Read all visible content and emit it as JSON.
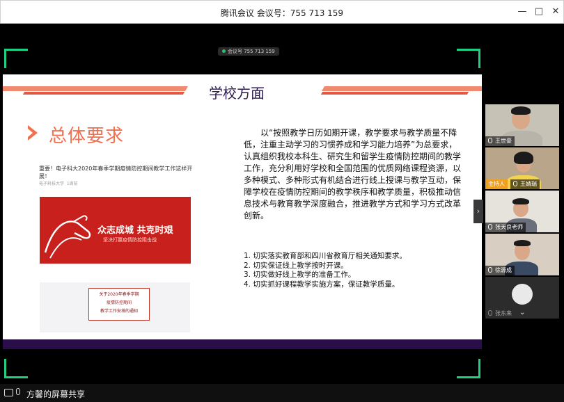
{
  "window": {
    "title": "腾讯会议 会议号：755 713 159",
    "minimize_glyph": "—",
    "maximize_glyph": "□",
    "close_glyph": "✕"
  },
  "meeting_tag": "会议号 755 713 159",
  "slide": {
    "title": "学校方面",
    "section_title": "总体要求",
    "news_headline": "重要！电子科大2020年春季学期疫情防控期间教学工作这样开展！",
    "news_source": "电子科技大学",
    "news_time": "1周前",
    "banner_text": "众志成城 共克时艰",
    "banner_subtext": "坚决打赢疫情防控阻击战",
    "notice_lines": [
      "关于2020年春季学期",
      "疫情防控期间",
      "教学工作安排的通知"
    ],
    "paragraph": "以“按照教学日历如期开课，教学要求与教学质量不降低，注重主动学习的习惯养成和学习能力培养”为总要求，认真组织我校本科生、研究生和留学生疫情防控期间的教学工作，充分利用好学校和全国范围的优质网络课程资源，以多种模式、多种形式有机结合进行线上授课与教学互动，保障学校在疫情防控期间的教学秩序和教学质量，积极推动信息技术与教育教学深度融合，推进教学方式和学习方式改革创新。",
    "list_items": [
      "1. 切实落实教育部和四川省教育厅相关通知要求。",
      "2. 切实保证线上教学按时开课。",
      "3. 切实做好线上教学的准备工作。",
      "4. 切实抓好课程教学实施方案，保证教学质量。"
    ]
  },
  "participants": [
    {
      "name": "王世豪",
      "host": false
    },
    {
      "name": "王婧瑞",
      "host": true,
      "host_label": "主持人"
    },
    {
      "name": "张天良老师",
      "host": false
    },
    {
      "name": "徐源成",
      "host": false
    },
    {
      "name": "张东来",
      "host": false
    }
  ],
  "bottombar": {
    "share_label": "方馨的屏幕共享"
  },
  "colors": {
    "accent": "#f07050",
    "slide_dark": "#2a0e4a",
    "corner_green": "#20d080",
    "host_badge": "#f0a020"
  },
  "icons": [
    "share-screen-icon",
    "mic-icon",
    "next-page-icon",
    "chevron-down-icon"
  ]
}
